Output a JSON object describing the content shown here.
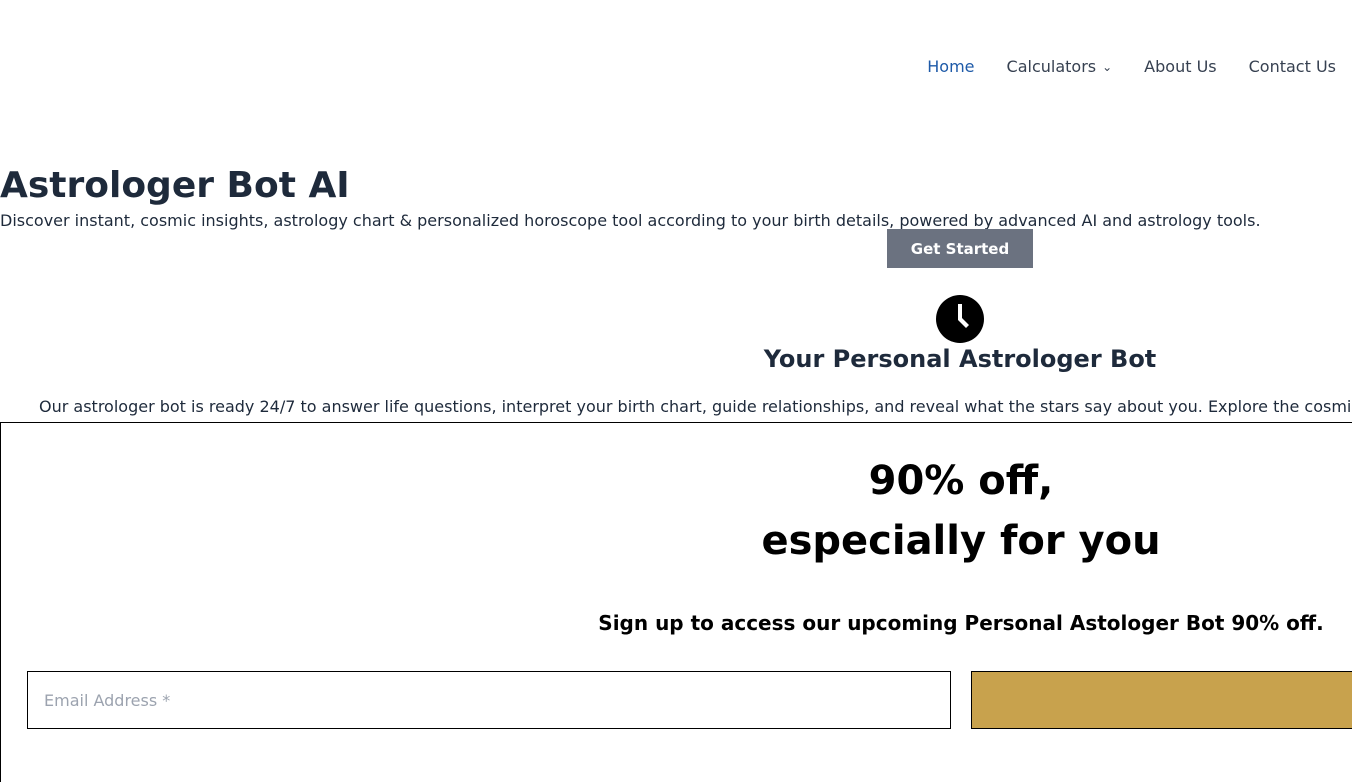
{
  "nav": {
    "items": [
      {
        "label": "Home"
      },
      {
        "label": "Calculators"
      },
      {
        "label": "About Us"
      },
      {
        "label": "Contact Us"
      }
    ]
  },
  "hero": {
    "title": "Astrologer Bot AI",
    "subtitle": "Discover instant, cosmic insights, astrology chart & personalized horoscope tool according to your birth details, powered by advanced AI and astrology tools.",
    "cta_label": "Get Started"
  },
  "feature": {
    "icon": "clock-icon",
    "title": "Your Personal Astrologer Bot",
    "text": "Our astrologer bot is ready 24/7 to answer life questions, interpret your birth chart, guide relationships, and reveal what the stars say about you. Explore the cosmi"
  },
  "popup": {
    "headline_line1": "90% off,",
    "headline_line2": "especially for you",
    "subtitle": "Sign up to access our upcoming Personal Astologer Bot 90% off.",
    "email_placeholder": "Email Address *",
    "submit_label": "",
    "accent_color": "#c8a24d"
  },
  "colors": {
    "nav_active": "#1e5aa8",
    "cta_bg": "#6b7280",
    "heading": "#1e2a3b"
  }
}
